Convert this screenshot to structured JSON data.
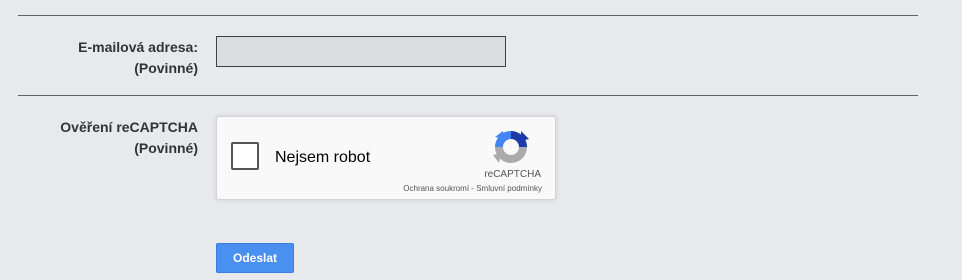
{
  "form": {
    "email": {
      "label_line1": "E-mailová adresa:",
      "label_line2": "(Povinné)",
      "value": ""
    },
    "captcha": {
      "label_line1": "Ověření reCAPTCHA",
      "label_line2": "(Povinné)",
      "checkbox_label": "Nejsem robot",
      "checked": false,
      "brand": "reCAPTCHA",
      "privacy_link": "Ochrana soukromí",
      "separator": " - ",
      "terms_link": "Smluvní podmínky",
      "logo_icon": "recaptcha-logo-icon",
      "logo_colors": [
        "#1c3aa9",
        "#4285f4",
        "#ababab"
      ]
    },
    "submit_label": "Odeslat",
    "accent_color": "#4a90f0"
  }
}
